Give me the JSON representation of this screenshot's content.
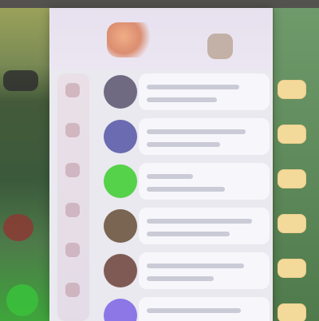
{
  "colors": {
    "panel_bg": "#e9e9ef",
    "card_bg": "#f6f6fb",
    "tag_bg": "#f3d99a"
  },
  "rows": [
    {
      "avatar_color": "#6f6a82",
      "title": "",
      "subtitle": ""
    },
    {
      "avatar_color": "#6a6bb0",
      "title": "",
      "subtitle": ""
    },
    {
      "avatar_color": "#56d14a",
      "title": "",
      "subtitle": ""
    },
    {
      "avatar_color": "#7a6452",
      "title": "",
      "subtitle": ""
    },
    {
      "avatar_color": "#7f5a55",
      "title": "",
      "subtitle": ""
    },
    {
      "avatar_color": "#8d77e6",
      "title": "",
      "subtitle": ""
    }
  ]
}
